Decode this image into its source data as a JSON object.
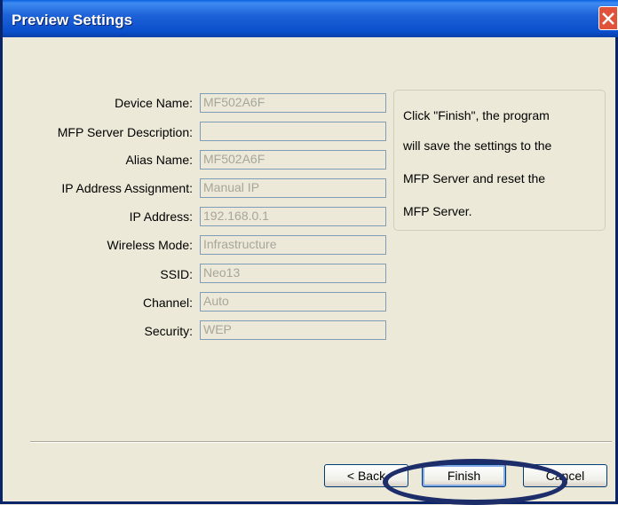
{
  "window": {
    "title": "Preview Settings"
  },
  "fields": [
    {
      "label": "Device Name:",
      "value": "MF502A6F"
    },
    {
      "label": "MFP Server Description:",
      "value": ""
    },
    {
      "label": "Alias Name:",
      "value": "MF502A6F"
    },
    {
      "label": "IP Address Assignment:",
      "value": "Manual IP"
    },
    {
      "label": "IP Address:",
      "value": "192.168.0.1"
    },
    {
      "label": "Wireless Mode:",
      "value": "Infrastructure"
    },
    {
      "label": "SSID:",
      "value": "Neo13"
    },
    {
      "label": "Channel:",
      "value": "Auto"
    },
    {
      "label": "Security:",
      "value": "WEP"
    }
  ],
  "info": {
    "lines": [
      "Click \"Finish\", the program",
      "will save the settings to the",
      "MFP Server and reset the",
      "MFP Server."
    ]
  },
  "buttons": {
    "back": "< Back",
    "finish": "Finish",
    "cancel": "Cancel"
  },
  "colors": {
    "titlebar": "#0A4FCB",
    "highlight_oval": "#1C2D6A"
  }
}
